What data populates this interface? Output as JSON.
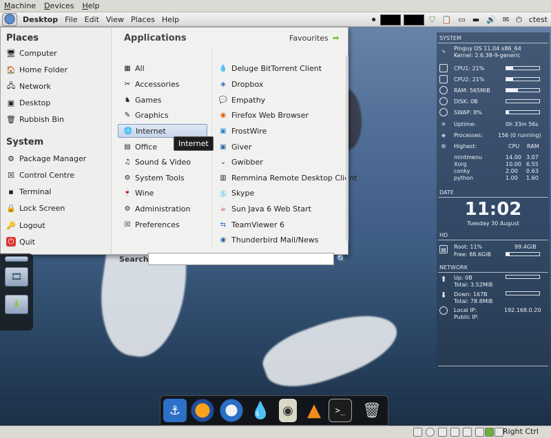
{
  "vbox_menu": [
    "Machine",
    "Devices",
    "Help"
  ],
  "top_panel": {
    "menus": [
      "Desktop",
      "File",
      "Edit",
      "View",
      "Places",
      "Help"
    ],
    "user": "ctest"
  },
  "start_menu": {
    "places_title": "Places",
    "places": [
      "Computer",
      "Home Folder",
      "Network",
      "Desktop",
      "Rubbish Bin"
    ],
    "system_title": "System",
    "system": [
      "Package Manager",
      "Control Centre",
      "Terminal",
      "Lock Screen",
      "Logout",
      "Quit"
    ],
    "applications_title": "Applications",
    "favourites_label": "Favourites",
    "categories": [
      "All",
      "Accessories",
      "Games",
      "Graphics",
      "Internet",
      "Office",
      "Sound & Video",
      "System Tools",
      "Wine",
      "Administration",
      "Preferences"
    ],
    "selected_category": "Internet",
    "apps": [
      "Deluge BitTorrent Client",
      "Dropbox",
      "Empathy",
      "Firefox Web Browser",
      "FrostWire",
      "Giver",
      "Gwibber",
      "Remmina Remote Desktop Client",
      "Skype",
      "Sun Java 6 Web Start",
      "TeamViewer 6",
      "Thunderbird Mail/News"
    ],
    "tooltip": "Internet",
    "search_label": "Search:",
    "search_value": ""
  },
  "conky": {
    "system_header": "SYSTEM",
    "os": "Pinguy OS 11.04 x86_64",
    "kernel": "Kernel: 2.6.38-9-generic",
    "cpu1": "CPU1: 21%",
    "cpu2": "CPU2: 21%",
    "ram": "RAM: 565MiB",
    "disk": "DISK: 0B",
    "swap": "SWAP: 8%",
    "uptime_label": "Uptime:",
    "uptime": "0h 33m 56s",
    "processes_label": "Processes:",
    "processes": "156 (0 running)",
    "highest_label": "Highest:",
    "col_cpu": "CPU",
    "col_ram": "RAM",
    "procs": [
      {
        "name": "mintmenu",
        "cpu": "14.00",
        "ram": "3.07"
      },
      {
        "name": "Xorg",
        "cpu": "10.00",
        "ram": "6.55"
      },
      {
        "name": "conky",
        "cpu": "2.00",
        "ram": "0.63"
      },
      {
        "name": "python",
        "cpu": "1.00",
        "ram": "1.60"
      }
    ],
    "date_header": "DATE",
    "time": "11:02",
    "date": "Tuesday 30 August",
    "hd_header": "HD",
    "root": "Root: 11%",
    "root_size": "99.4GiB",
    "free": "Free: 88.6GiB",
    "network_header": "NETWORK",
    "up": "Up: 0B",
    "up_total": "Total: 3.52MiB",
    "down": "Down: 167B",
    "down_total": "Total: 78.8MiB",
    "local_ip_label": "Local IP:",
    "local_ip": "192.168.0.20",
    "public_ip_label": "Public IP:",
    "bars": {
      "cpu1": 0.21,
      "cpu2": 0.21,
      "ram": 0.35,
      "disk": 0.0,
      "swap": 0.08,
      "root": 0.11,
      "free": 0.11
    }
  },
  "status_bar": {
    "host_key": "Right Ctrl"
  }
}
